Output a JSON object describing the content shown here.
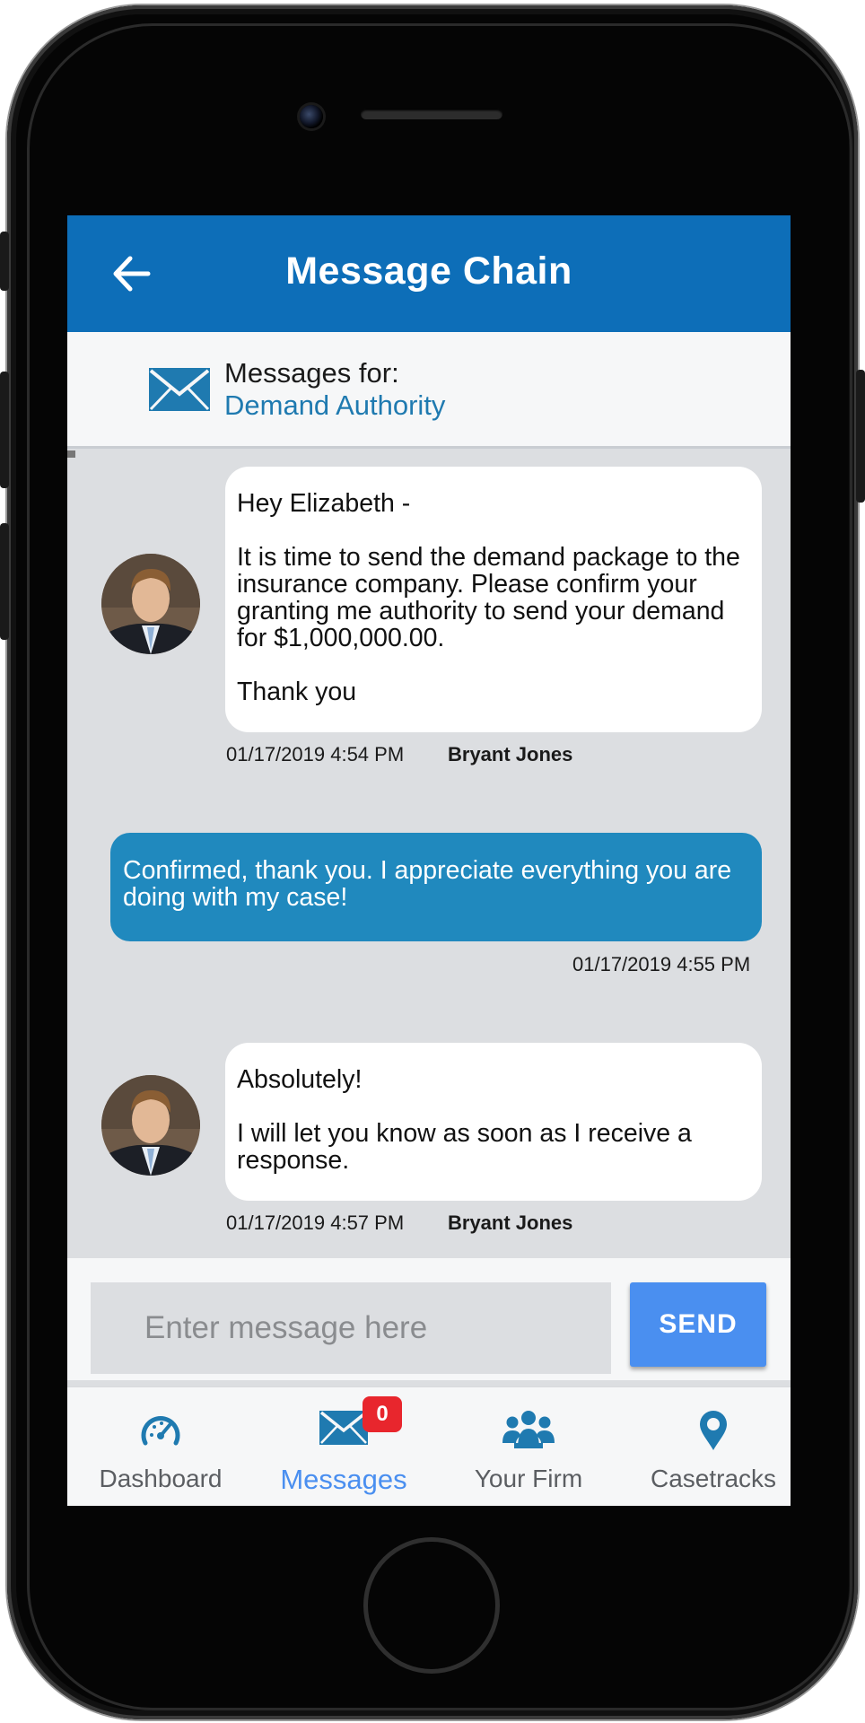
{
  "header": {
    "title": "Message Chain",
    "back_icon": "arrow-left-icon"
  },
  "subject": {
    "icon": "envelope-icon",
    "label": "Messages for:",
    "name": "Demand Authority"
  },
  "messages": [
    {
      "direction": "incoming",
      "text": "Hey Elizabeth -\n\nIt is time to send the demand package to the insurance company. Please confirm your granting me authority to send your demand for $1,000,000.00.\n\nThank you",
      "timestamp": "01/17/2019 4:54 PM",
      "sender": "Bryant Jones"
    },
    {
      "direction": "outgoing",
      "text": "Confirmed, thank you. I appreciate everything you are doing with my case!",
      "timestamp": "01/17/2019 4:55 PM"
    },
    {
      "direction": "incoming",
      "text": "Absolutely!\n\nI will let you know as soon as I receive a response.",
      "timestamp": "01/17/2019 4:57 PM",
      "sender": "Bryant Jones"
    }
  ],
  "composer": {
    "placeholder": "Enter message here",
    "value": "",
    "send_label": "SEND"
  },
  "nav": {
    "items": [
      {
        "label": "Dashboard",
        "icon": "speedometer-icon",
        "active": false
      },
      {
        "label": "Messages",
        "icon": "envelope-icon",
        "active": true,
        "badge": "0"
      },
      {
        "label": "Your Firm",
        "icon": "people-icon",
        "active": false
      },
      {
        "label": "Casetracks",
        "icon": "map-pin-icon",
        "active": false
      }
    ]
  },
  "colors": {
    "header": "#0d6eb8",
    "outgoing_bubble": "#2089be",
    "accent": "#4a8ff0",
    "badge": "#e8262d",
    "chat_background": "#dcdee1"
  }
}
